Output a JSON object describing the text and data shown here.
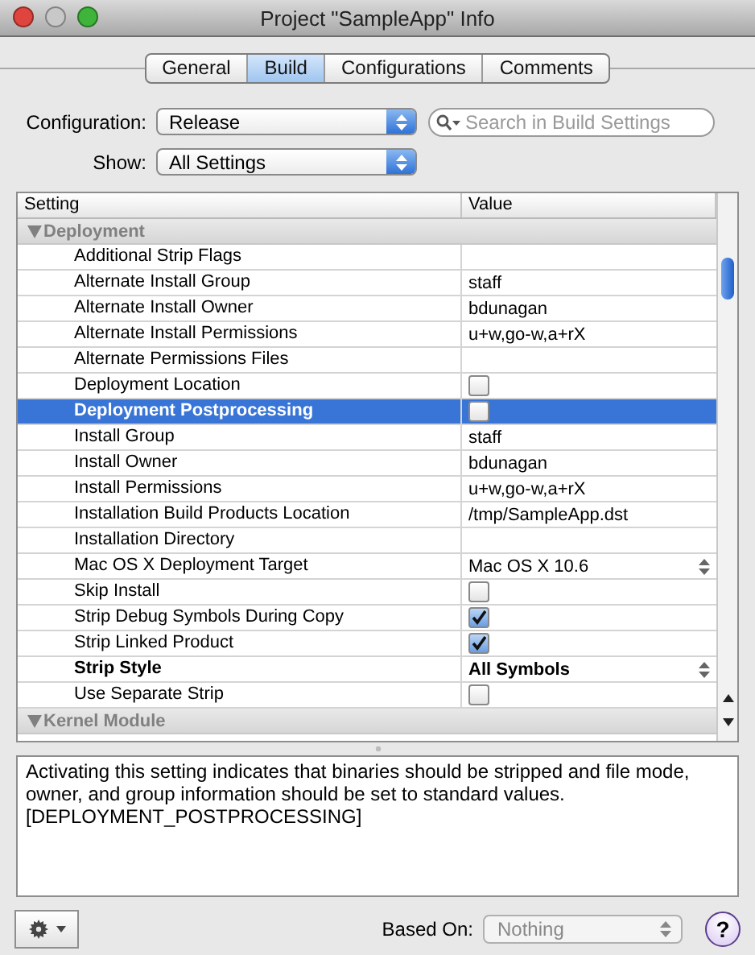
{
  "window": {
    "title": "Project \"SampleApp\" Info"
  },
  "tabs": [
    {
      "label": "General",
      "selected": false
    },
    {
      "label": "Build",
      "selected": true
    },
    {
      "label": "Configurations",
      "selected": false
    },
    {
      "label": "Comments",
      "selected": false
    }
  ],
  "configuration": {
    "label": "Configuration:",
    "value": "Release"
  },
  "search": {
    "placeholder": "Search in Build Settings"
  },
  "show": {
    "label": "Show:",
    "value": "All Settings"
  },
  "table": {
    "columns": [
      "Setting",
      "Value"
    ],
    "groups": [
      {
        "label": "Deployment",
        "expanded": true,
        "rows": [
          {
            "name": "Additional Strip Flags",
            "kind": "text",
            "value": "",
            "bold": false,
            "selected": false
          },
          {
            "name": "Alternate Install Group",
            "kind": "text",
            "value": "staff",
            "bold": false,
            "selected": false
          },
          {
            "name": "Alternate Install Owner",
            "kind": "text",
            "value": "bdunagan",
            "bold": false,
            "selected": false
          },
          {
            "name": "Alternate Install Permissions",
            "kind": "text",
            "value": "u+w,go-w,a+rX",
            "bold": false,
            "selected": false
          },
          {
            "name": "Alternate Permissions Files",
            "kind": "text",
            "value": "",
            "bold": false,
            "selected": false
          },
          {
            "name": "Deployment Location",
            "kind": "checkbox",
            "checked": false,
            "bold": false,
            "selected": false
          },
          {
            "name": "Deployment Postprocessing",
            "kind": "checkbox",
            "checked": false,
            "bold": true,
            "selected": true
          },
          {
            "name": "Install Group",
            "kind": "text",
            "value": "staff",
            "bold": false,
            "selected": false
          },
          {
            "name": "Install Owner",
            "kind": "text",
            "value": "bdunagan",
            "bold": false,
            "selected": false
          },
          {
            "name": "Install Permissions",
            "kind": "text",
            "value": "u+w,go-w,a+rX",
            "bold": false,
            "selected": false
          },
          {
            "name": "Installation Build Products Location",
            "kind": "text",
            "value": "/tmp/SampleApp.dst",
            "bold": false,
            "selected": false
          },
          {
            "name": "Installation Directory",
            "kind": "text",
            "value": "",
            "bold": false,
            "selected": false
          },
          {
            "name": "Mac OS X Deployment Target",
            "kind": "popup",
            "value": "Mac OS X 10.6",
            "bold": false,
            "selected": false
          },
          {
            "name": "Skip Install",
            "kind": "checkbox",
            "checked": false,
            "bold": false,
            "selected": false
          },
          {
            "name": "Strip Debug Symbols During Copy",
            "kind": "checkbox",
            "checked": true,
            "bold": false,
            "selected": false
          },
          {
            "name": "Strip Linked Product",
            "kind": "checkbox",
            "checked": true,
            "bold": false,
            "selected": false
          },
          {
            "name": "Strip Style",
            "kind": "popup",
            "value": "All Symbols",
            "bold": true,
            "selected": false
          },
          {
            "name": "Use Separate Strip",
            "kind": "checkbox",
            "checked": false,
            "bold": false,
            "selected": false
          }
        ]
      },
      {
        "label": "Kernel Module",
        "expanded": true
      }
    ]
  },
  "description": "Activating this setting indicates that binaries should be stripped and file mode, owner, and group information should be set to standard values. [DEPLOYMENT_POSTPROCESSING]",
  "based_on": {
    "label": "Based On:",
    "value": "Nothing",
    "disabled": true
  },
  "help": {
    "label": "?"
  }
}
